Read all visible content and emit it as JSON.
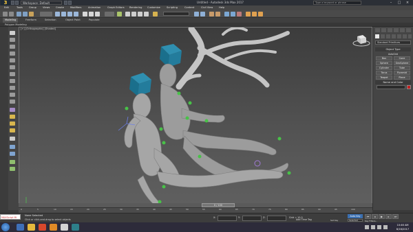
{
  "titlebar": {
    "logo": "3",
    "workspace": "Workspace: Default",
    "window_title": "Untitled - Autodesk 3ds Max 2017",
    "search_placeholder": "Type a keyword or phrase"
  },
  "menubar": {
    "items": [
      "Edit",
      "Tools",
      "Group",
      "Views",
      "Create",
      "Modifiers",
      "Animation",
      "Graph Editors",
      "Rendering",
      "Customize",
      "Scripting",
      "Content",
      "Civil View",
      "Help"
    ]
  },
  "main_toolbar": {
    "selection_set_placeholder": "Create Selection Set"
  },
  "ribbon": {
    "tabs": [
      "Modeling",
      "Freeform",
      "Selection",
      "Object Paint",
      "Populate"
    ],
    "active": "Modeling",
    "sub": "Polygon Modeling"
  },
  "viewport": {
    "label": "[+] [Orthographic] [Shaded]"
  },
  "command_panel": {
    "dropdown": "Standard Primitives",
    "rollout_object_type": "Object Type",
    "autogrid": "AutoGrid",
    "buttons": [
      "Box",
      "Cone",
      "Sphere",
      "GeoSphere",
      "Cylinder",
      "Tube",
      "Torus",
      "Pyramid",
      "Teapot",
      "Plane"
    ],
    "rollout_name_color": "Name and Color",
    "color": "#c41f1f"
  },
  "timeline": {
    "frame_label": "0 / 100",
    "ticks": [
      "0",
      "5",
      "10",
      "15",
      "20",
      "25",
      "30",
      "35",
      "40",
      "45",
      "50",
      "55",
      "60",
      "65",
      "70",
      "75",
      "80",
      "85",
      "90",
      "95",
      "100"
    ]
  },
  "statusbar": {
    "maxscript": "MAXScript Mi",
    "status": "None Selected",
    "prompt": "Click or click-and-drag to select objects",
    "x_label": "X:",
    "y_label": "Y:",
    "z_label": "Z:",
    "grid_label": "Grid = 10.0",
    "autokey": "Auto Key",
    "setkey": "Set Key",
    "selected_option": "Selected",
    "add_time_tag": "Add Time Tag",
    "key_filters": "Key Filters..."
  },
  "taskbar": {
    "time": "10:46 AM",
    "date": "8/16/2017"
  }
}
